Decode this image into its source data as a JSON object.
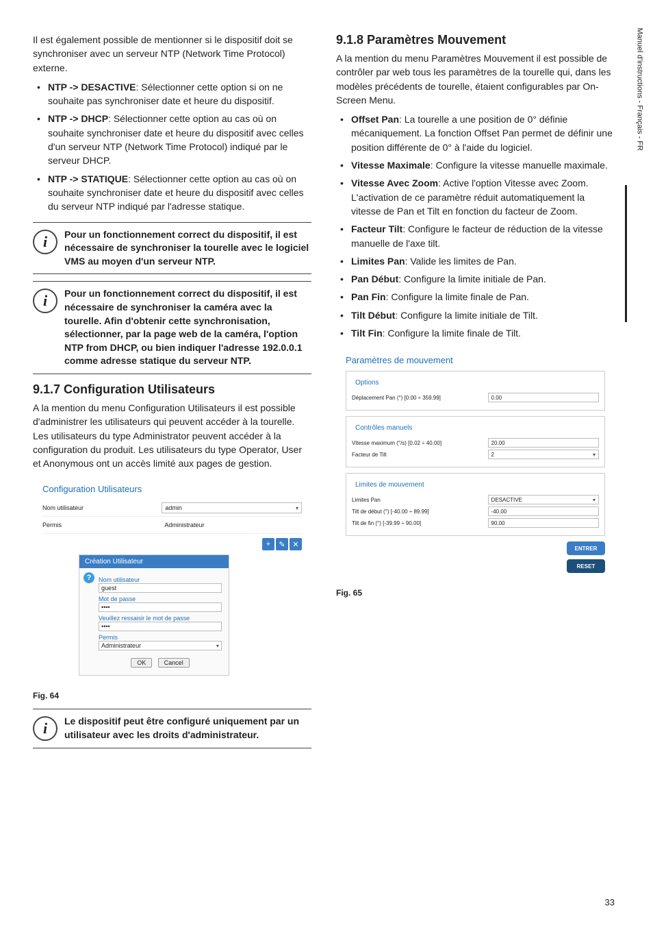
{
  "side_label": "Manuel d'instructions - Français - FR",
  "page_number": "33",
  "left": {
    "intro": "Il est également possible de mentionner si le dispositif doit se synchroniser avec un serveur NTP (Network Time Protocol) externe.",
    "bul1_strong": "NTP -> DESACTIVE",
    "bul1_rest": ": Sélectionner cette option si on ne souhaite pas synchroniser date et heure du dispositif.",
    "bul2_strong": "NTP -> DHCP",
    "bul2_rest": ": Sélectionner cette option au cas où on souhaite synchroniser date et heure du dispositif avec celles d'un serveur NTP (Network Time Protocol) indiqué par le serveur DHCP.",
    "bul3_strong": "NTP -> STATIQUE",
    "bul3_rest": ": Sélectionner cette option au cas où on souhaite synchroniser date et heure du dispositif avec celles du serveur NTP indiqué par l'adresse statique.",
    "info1": "Pour un fonctionnement correct du dispositif, il est nécessaire de synchroniser la tourelle avec le logiciel VMS au moyen d'un serveur NTP.",
    "info2": "Pour un fonctionnement correct du dispositif, il est nécessaire de synchroniser la caméra avec la tourelle. Afin d'obtenir cette synchronisation, sélectionner, par la page web de la caméra, l'option NTP from DHCP, ou bien indiquer l'adresse 192.0.0.1 comme adresse statique du serveur NTP.",
    "h917": "9.1.7 Configuration Utilisateurs",
    "p917": "A la mention du menu Configuration Utilisateurs il est possible d'administrer les utilisateurs qui peuvent accéder à la tourelle. Les utilisateurs du type Administrator peuvent accéder à la configuration du produit. Les utilisateurs du type Operator, User et Anonymous ont un accès limité aux pages de gestion.",
    "fig64": "Fig. 64",
    "info3": "Le dispositif peut être configuré uniquement par un utilisateur avec les droits d'administrateur.",
    "shot": {
      "title": "Configuration Utilisateurs",
      "row1_lab": "Nom utilisateur",
      "row1_val": "admin",
      "row2_lab": "Permis",
      "row2_val": "Administrateur",
      "tbtn_add": "+",
      "tbtn_edit": "✎",
      "tbtn_del": "✕",
      "modal_head": "Création Utilisateur",
      "m_lab1": "Nom utilisateur",
      "m_val1": "guest",
      "m_lab2": "Mot de passe",
      "m_val2": "••••",
      "m_lab3": "Veuillez ressaisir le mot de passe",
      "m_val3": "••••",
      "m_lab4": "Permis",
      "m_val4": "Administrateur",
      "ok": "OK",
      "cancel": "Cancel"
    }
  },
  "right": {
    "h918": "9.1.8 Paramètres Mouvement",
    "p918": "A la mention du menu Paramètres Mouvement il est possible de contrôler par web tous les paramètres de la tourelle qui, dans les modèles précédents de tourelle, étaient configurables par On-Screen Menu.",
    "b1s": "Offset Pan",
    "b1r": ": La tourelle a une position de 0° définie mécaniquement. La fonction Offset Pan permet de définir une position différente de 0° à l'aide du logiciel.",
    "b2s": "Vitesse Maximale",
    "b2r": ": Configure la vitesse manuelle maximale.",
    "b3s": "Vitesse Avec Zoom",
    "b3r": ": Active l'option Vitesse avec Zoom. L'activation de ce paramètre réduit automatiquement la vitesse de Pan et Tilt en fonction du facteur de Zoom.",
    "b4s": "Facteur Tilt",
    "b4r": ": Configure le facteur de réduction de la vitesse manuelle de l'axe tilt.",
    "b5s": "Limites Pan",
    "b5r": ": Valide les limites de Pan.",
    "b6s": "Pan Début",
    "b6r": ": Configure la limite initiale de Pan.",
    "b7s": "Pan Fin",
    "b7r": ": Configure la limite finale de Pan.",
    "b8s": "Tilt Début",
    "b8r": ": Configure la limite initiale de Tilt.",
    "b9s": "Tilt Fin",
    "b9r": ": Configure la limite finale de Tilt.",
    "fig65": "Fig. 65",
    "shot": {
      "title": "Paramètres de mouvement",
      "leg_options": "Options",
      "opt1_lab": "Déplacement Pan (°) [0.00 ÷ 359.99]",
      "opt1_val": "0.00",
      "leg_ctrl": "Contrôles manuels",
      "ctrl1_lab": "Vitesse maximum (°/s) [0.02 ÷ 40.00]",
      "ctrl1_val": "20.00",
      "ctrl2_lab": "Facteur de Tilt",
      "ctrl2_val": "2",
      "leg_lim": "Limites de mouvement",
      "lim1_lab": "Limites Pan",
      "lim1_val": "DESACTIVE",
      "lim2_lab": "Tilt de début (°) [-40.00 ÷ 89.99]",
      "lim2_val": "-40.00",
      "lim3_lab": "Tilt de fin (°) [-39.99 ÷ 90.00]",
      "lim3_val": "90.00",
      "btn_entrer": "ENTRER",
      "btn_reset": "RESET"
    }
  }
}
